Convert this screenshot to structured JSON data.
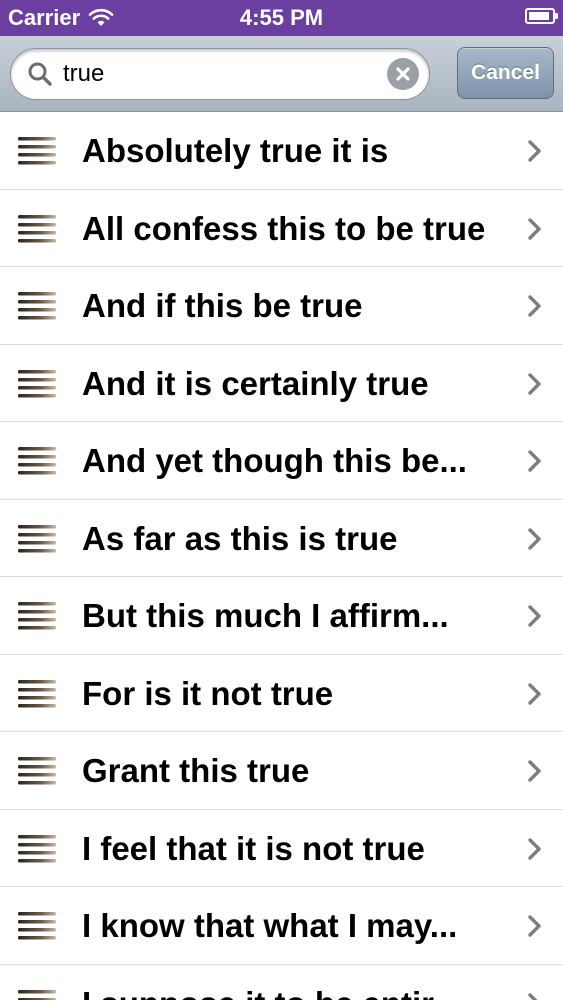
{
  "status_bar": {
    "carrier": "Carrier",
    "time": "4:55 PM",
    "battery_level": 0.9,
    "bar_color": "#6a3fa0"
  },
  "search": {
    "value": "true",
    "placeholder": "",
    "cancel_label": "Cancel",
    "search_icon": "magnifier-icon",
    "clear_icon": "clear-x-icon"
  },
  "results": [
    {
      "label": "Absolutely true it is",
      "icon": "lines-icon"
    },
    {
      "label": "All confess this to be true",
      "icon": "lines-icon"
    },
    {
      "label": "And if this be true",
      "icon": "lines-icon"
    },
    {
      "label": "And it is certainly true",
      "icon": "lines-icon"
    },
    {
      "label": "And yet though this be...",
      "icon": "lines-icon"
    },
    {
      "label": "As far as this is true",
      "icon": "lines-icon"
    },
    {
      "label": "But this much I affirm...",
      "icon": "lines-icon"
    },
    {
      "label": "For is it not true",
      "icon": "lines-icon"
    },
    {
      "label": "Grant this true",
      "icon": "lines-icon"
    },
    {
      "label": "I feel that it is not true",
      "icon": "lines-icon"
    },
    {
      "label": "I know that what I may...",
      "icon": "lines-icon"
    },
    {
      "label": "I suppose it to be entir...",
      "icon": "lines-icon"
    }
  ]
}
